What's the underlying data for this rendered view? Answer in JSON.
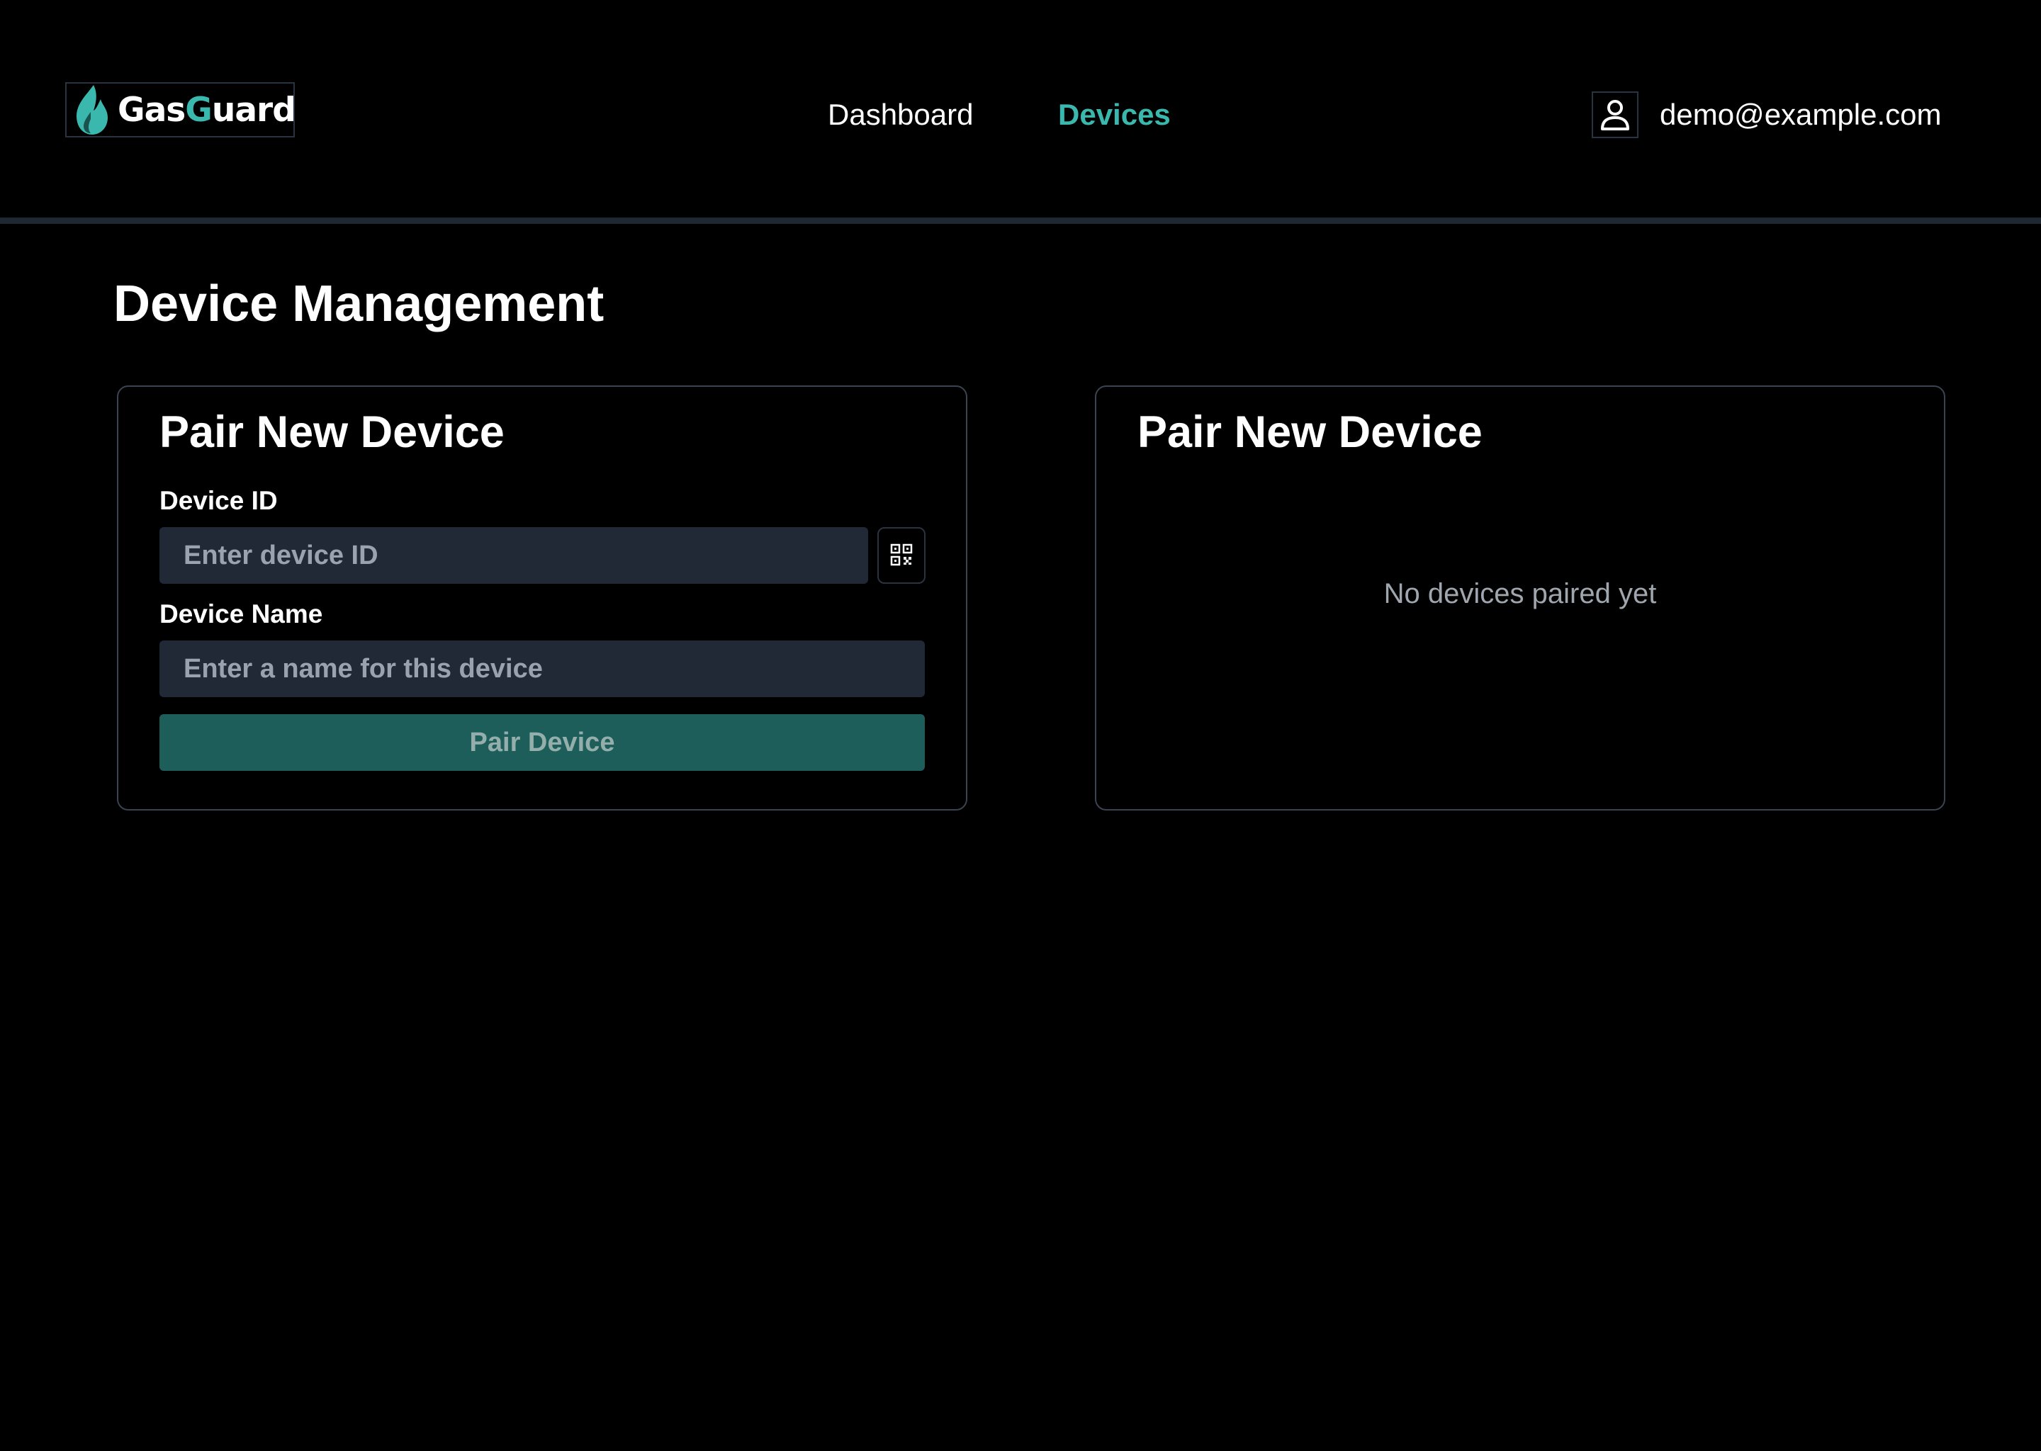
{
  "header": {
    "logo": {
      "text_primary": "Gas",
      "text_accent_letter": "G",
      "text_rest": "uard",
      "icon": "flame-icon"
    },
    "nav": {
      "items": [
        {
          "label": "Dashboard",
          "active": false
        },
        {
          "label": "Devices",
          "active": true
        }
      ]
    },
    "user": {
      "icon": "user-icon",
      "email": "demo@example.com"
    }
  },
  "main": {
    "title": "Device Management",
    "pair_card": {
      "title": "Pair New Device",
      "device_id": {
        "label": "Device ID",
        "value": "",
        "placeholder": "Enter device ID"
      },
      "qr_scan_icon": "qr-code-icon",
      "device_name": {
        "label": "Device Name",
        "value": "",
        "placeholder": "Enter a name for this device"
      },
      "submit_label": "Pair Device"
    },
    "devices_card": {
      "title": "Pair New Device",
      "empty_message": "No devices paired yet"
    }
  },
  "colors": {
    "background": "#000000",
    "accent": "#3bb8ae",
    "input_bg": "#212937",
    "button_bg": "#1d5e5a",
    "divider": "#1f2733"
  }
}
